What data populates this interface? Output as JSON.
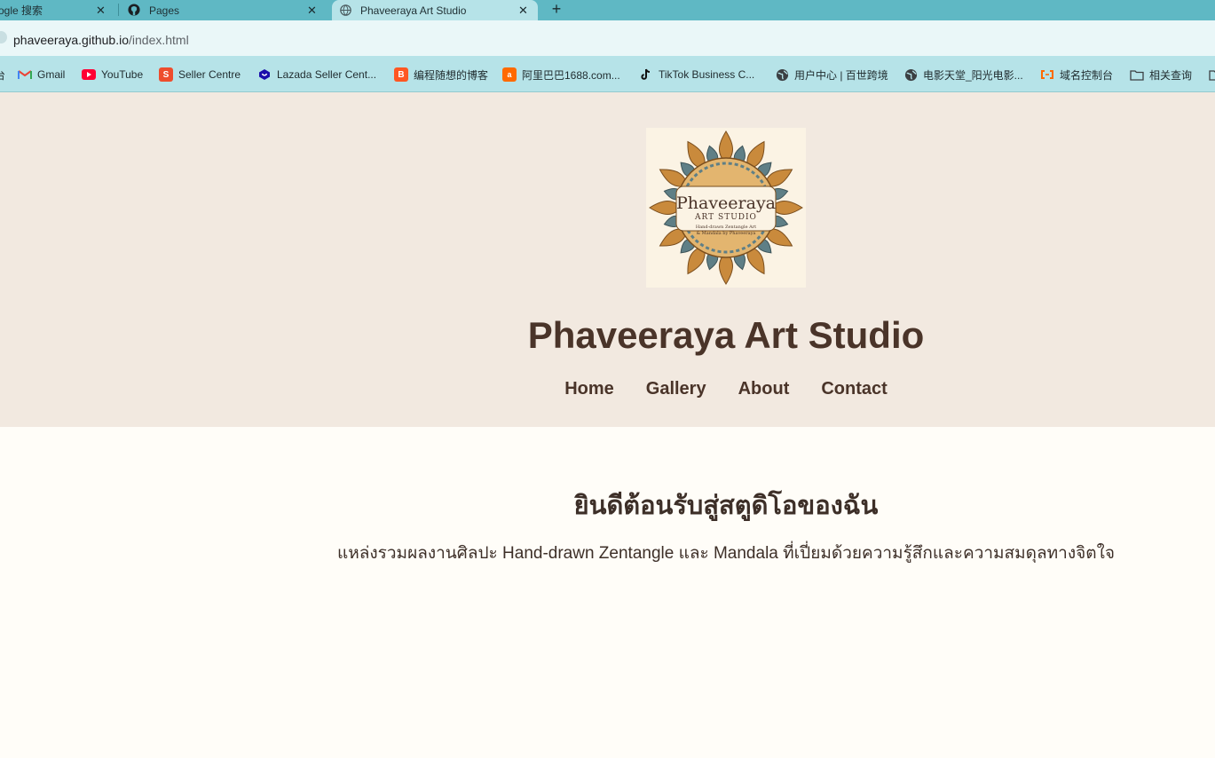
{
  "browser": {
    "tabs": [
      {
        "title": "ogle 搜索"
      },
      {
        "title": "Pages"
      },
      {
        "title": "Phaveeraya Art Studio",
        "active": true
      }
    ],
    "tab_close_glyph": "✕",
    "new_tab_glyph": "+",
    "url": {
      "host": "phaveeraya.github.io",
      "path": "/index.html"
    },
    "bookmarks": [
      {
        "label": "Gmail",
        "icon": "gmail-icon"
      },
      {
        "label": "YouTube",
        "icon": "youtube-icon"
      },
      {
        "label": "Seller Centre",
        "icon": "shopee-icon"
      },
      {
        "label": "Lazada Seller Cent...",
        "icon": "lazada-icon"
      },
      {
        "label": "编程随想的博客",
        "icon": "blogger-icon"
      },
      {
        "label": "阿里巴巴1688.com...",
        "icon": "alibaba-icon"
      },
      {
        "label": "TikTok Business C...",
        "icon": "tiktok-icon"
      },
      {
        "label": "用户中心 | 百世跨境",
        "icon": "globe-icon"
      },
      {
        "label": "电影天堂_阳光电影...",
        "icon": "globe-icon"
      },
      {
        "label": "域名控制台",
        "icon": "aliyun-icon"
      },
      {
        "label": "相关查询",
        "icon": "folder-icon"
      }
    ],
    "colors": {
      "tabstrip": "#5fb8c4",
      "active_tab": "#b6e3e8",
      "address_bar": "#eaf7f8"
    }
  },
  "site": {
    "logo": {
      "title": "Phaveeraya",
      "subtitle": "ART STUDIO",
      "tagline_1": "Hand-drawn Zentangle Art",
      "tagline_2": "& Mandala by Phaveeraya"
    },
    "title": "Phaveeraya Art Studio",
    "nav": [
      "Home",
      "Gallery",
      "About",
      "Contact"
    ],
    "welcome": "ยินดีต้อนรับสู่สตูดิโอของฉัน",
    "subtitle": "แหล่งรวมผลงานศิลปะ Hand-drawn Zentangle และ Mandala ที่เปี่ยมด้วยความรู้สึกและความสมดุลทางจิตใจ",
    "colors": {
      "header_bg": "#f2e9e0",
      "text": "#4a3429",
      "page_bg": "#fffdf8"
    }
  }
}
